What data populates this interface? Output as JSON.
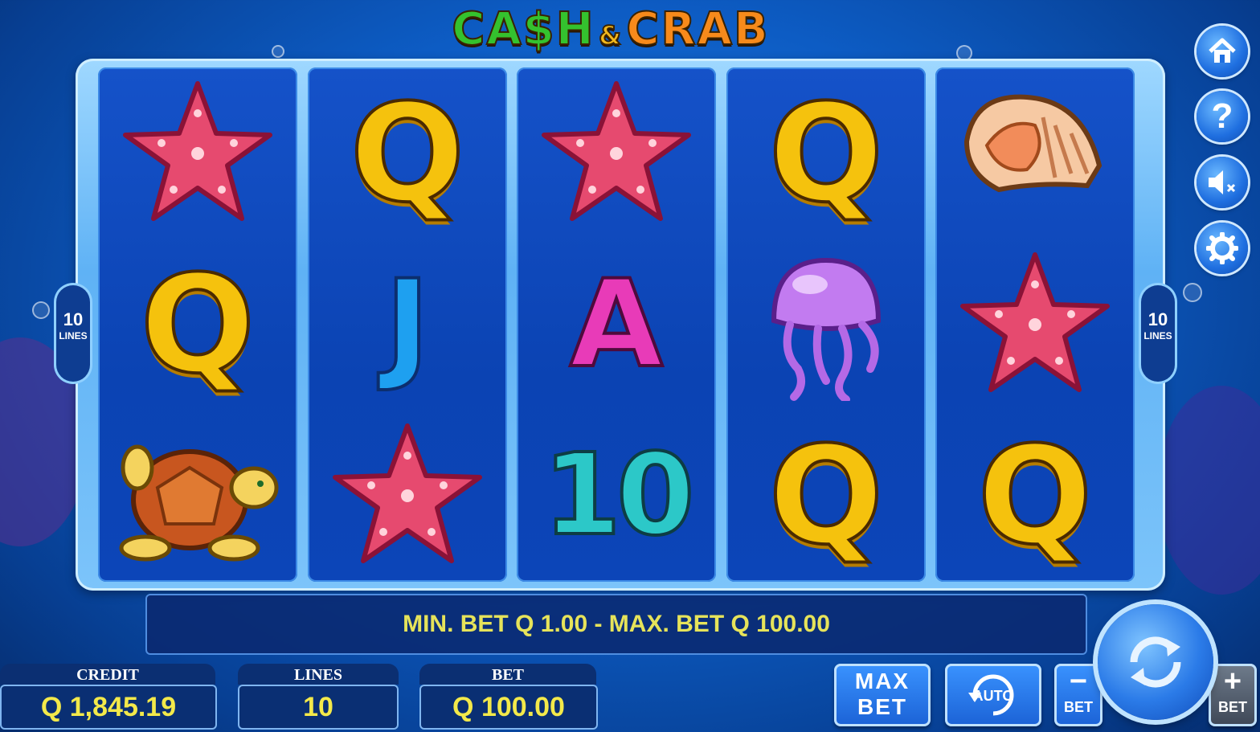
{
  "game": {
    "title_part1": "CA$H",
    "title_amp": "&",
    "title_part2": "CRAB"
  },
  "reels": [
    [
      "starfish-icon",
      "Q",
      "turtle-icon"
    ],
    [
      "Q",
      "J",
      "starfish-icon"
    ],
    [
      "starfish-icon",
      "A",
      "10"
    ],
    [
      "Q",
      "jellyfish-icon",
      "Q"
    ],
    [
      "shell-icon",
      "starfish-icon",
      "Q"
    ]
  ],
  "lines_badge": {
    "number": "10",
    "label": "LINES"
  },
  "info_message": "MIN. BET Q 1.00 - MAX. BET Q 100.00",
  "credit": {
    "label": "CREDIT",
    "value": "Q 1,845.19"
  },
  "lines": {
    "label": "LINES",
    "value": "10"
  },
  "bet": {
    "label": "BET",
    "value": "Q 100.00"
  },
  "buttons": {
    "max_bet_line1": "MAX",
    "max_bet_line2": "BET",
    "auto": "AUTO",
    "bet_minus_label": "BET",
    "bet_plus_label": "BET"
  },
  "icons": [
    "home-icon",
    "help-icon",
    "sound-muted-icon",
    "settings-icon",
    "spin-icon"
  ],
  "colors": {
    "accent_yellow": "#f3e94a",
    "title_green": "#34c22e",
    "title_orange": "#f78a1b"
  }
}
